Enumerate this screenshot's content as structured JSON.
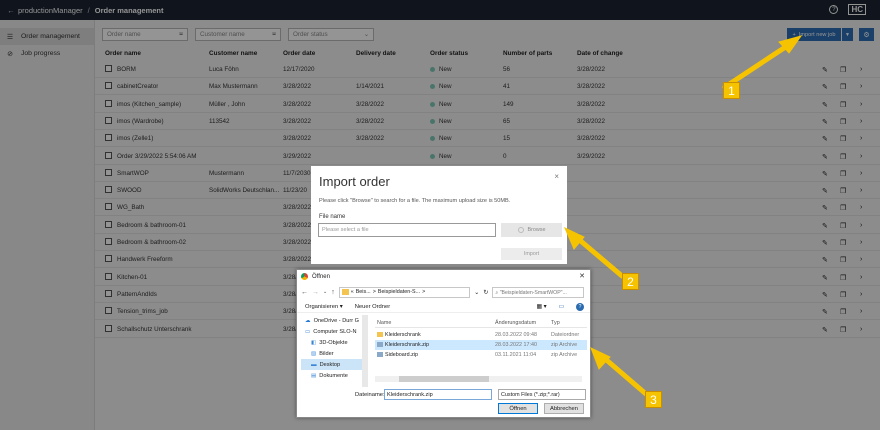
{
  "topbar": {
    "app": "productionManager",
    "separator": "/",
    "section": "Order management",
    "help_icon": "?",
    "logo": "HC"
  },
  "sidebar": {
    "items": [
      {
        "label": "Order management",
        "icon": "list-icon"
      },
      {
        "label": "Job progress",
        "icon": "check-circle-icon"
      }
    ]
  },
  "filters": {
    "order_name": "Order name",
    "customer_name": "Customer name",
    "order_status": "Order status"
  },
  "import_button": {
    "label": "Import new job",
    "plus": "+"
  },
  "table": {
    "headers": [
      "Order name",
      "Customer name",
      "Order date",
      "Delivery date",
      "Order status",
      "Number of parts",
      "Date of change"
    ],
    "rows": [
      [
        "BORM",
        "Luca Föhn",
        "12/17/2020",
        "",
        "New",
        "56",
        "3/28/2022"
      ],
      [
        "cabinetCreator",
        "Max Mustermann",
        "3/28/2022",
        "1/14/2021",
        "New",
        "41",
        "3/28/2022"
      ],
      [
        "imos (Kitchen_sample)",
        "Müller , John",
        "3/28/2022",
        "3/28/2022",
        "New",
        "149",
        "3/28/2022"
      ],
      [
        "imos (Wardrobe)",
        "113542",
        "3/28/2022",
        "3/28/2022",
        "New",
        "65",
        "3/28/2022"
      ],
      [
        "imos (Zelle1)",
        "",
        "3/28/2022",
        "3/28/2022",
        "New",
        "15",
        "3/28/2022"
      ],
      [
        "Order 3/29/2022 5:54:06 AM",
        "",
        "3/29/2022",
        "",
        "New",
        "0",
        "3/29/2022"
      ],
      [
        "SmartWOP",
        "Mustermann",
        "11/7/2030",
        "",
        "",
        "",
        ""
      ],
      [
        "SWOOD",
        "SolidWorks Deutschlan...",
        "11/23/20",
        "",
        "",
        "",
        ""
      ],
      [
        "WG_Bath",
        "",
        "3/28/2022",
        "",
        "",
        "",
        ""
      ],
      [
        "Bedroom & bathroom-01",
        "",
        "3/28/2022",
        "",
        "",
        "",
        ""
      ],
      [
        "Bedroom & bathroom-02",
        "",
        "3/28/2022",
        "",
        "",
        "",
        ""
      ],
      [
        "Handwerk Freeform",
        "",
        "3/28/2022",
        "",
        "",
        "",
        ""
      ],
      [
        "Kitchen-01",
        "",
        "3/28/2022",
        "",
        "",
        "",
        ""
      ],
      [
        "PatternAndIds",
        "",
        "3/28/2022",
        "",
        "",
        "",
        ""
      ],
      [
        "Tension_trims_job",
        "",
        "3/28/2022",
        "",
        "",
        "",
        ""
      ],
      [
        "Schallschutz Unterschrank",
        "",
        "3/28/2022",
        "",
        "",
        "",
        ""
      ]
    ]
  },
  "import_modal": {
    "title": "Import order",
    "description": "Please click \"Browse\" to search for a file. The maximum upload size is 50MB.",
    "file_label": "File name",
    "file_placeholder": "Please select a file",
    "browse": "Browse",
    "import": "Import",
    "close": "×"
  },
  "file_dialog": {
    "title": "Öffnen",
    "close": "✕",
    "path": [
      "«",
      "Beis...",
      ">",
      "Beispieldaten-S...",
      ">"
    ],
    "search_placeholder": "\"Beispieldaten-SmartWOP\"...",
    "organize": "Organisieren ▾",
    "new_folder": "Neuer Ordner",
    "tree": [
      "OneDrive - Durr G",
      "Computer SLO-N",
      "3D-Objekte",
      "Bilder",
      "Desktop",
      "Dokumente"
    ],
    "columns": [
      "Name",
      "Änderungsdatum",
      "Typ"
    ],
    "files": [
      {
        "name": "Kleiderschrank",
        "date": "28.03.2022 09:48",
        "type": "Dateiordner"
      },
      {
        "name": "Kleiderschrank.zip",
        "date": "28.03.2022 17:40",
        "type": "zip Archive"
      },
      {
        "name": "Sideboard.zip",
        "date": "03.11.2021 11:04",
        "type": "zip Archive"
      }
    ],
    "filename_label": "Dateiname:",
    "filename_value": "Kleiderschrank.zip",
    "filter_value": "Custom Files (*.zip;*.rar)",
    "open": "Öffnen",
    "cancel": "Abbrechen"
  },
  "callouts": [
    "1",
    "2",
    "3"
  ],
  "colors": {
    "topbar": "#1b2432",
    "accent": "#2e6fb5",
    "status_dot": "#7fc9b6",
    "callout": "#f6c300"
  }
}
